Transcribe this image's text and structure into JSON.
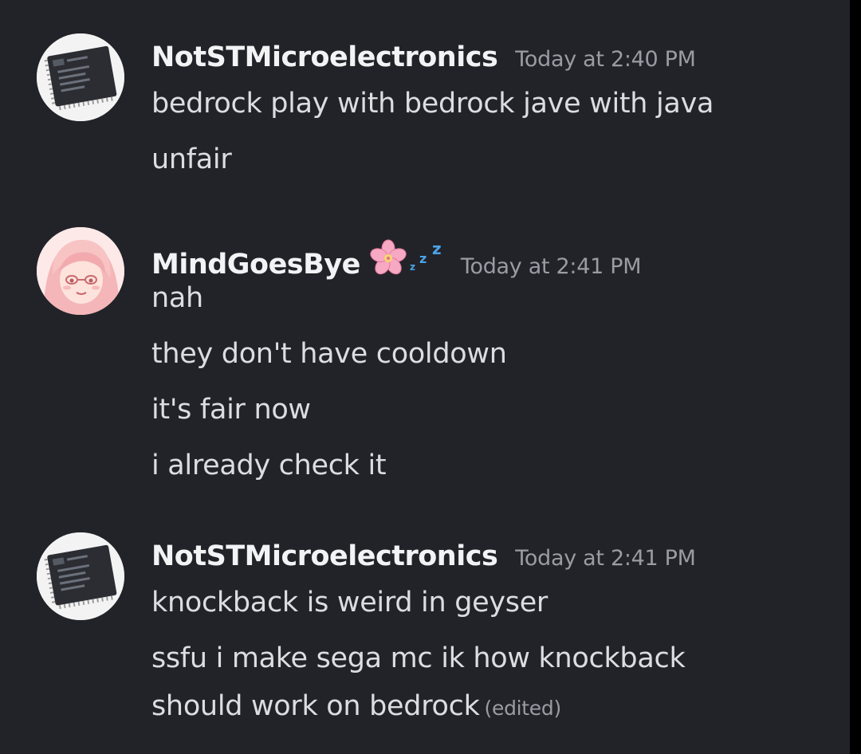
{
  "messages": [
    {
      "username": "NotSTMicroelectronics",
      "timestamp": "Today at 2:40 PM",
      "avatar_icon": "microchip-icon",
      "lines": [
        "bedrock play with bedrock jave with java",
        "unfair"
      ]
    },
    {
      "username": "MindGoesBye",
      "timestamp": "Today at 2:41 PM",
      "avatar_icon": "anime-girl-avatar",
      "badges": [
        "cherry-blossom-icon",
        "sleeping-zzz-icon"
      ],
      "lines": [
        "nah",
        "they don't have cooldown",
        "it's fair now",
        "i already check it"
      ]
    },
    {
      "username": "NotSTMicroelectronics",
      "timestamp": "Today at 2:41 PM",
      "avatar_icon": "microchip-icon",
      "lines": [
        "knockback is weird in geyser",
        "ssfu i make sega mc ik how knockback",
        "should work on bedrock"
      ],
      "edited_label": "(edited)"
    }
  ],
  "colors": {
    "background": "#222329",
    "username": "#f2f3f5",
    "message_text": "#dcdde1",
    "timestamp": "#9a9ca3",
    "zzz": "#4aa3e8"
  }
}
